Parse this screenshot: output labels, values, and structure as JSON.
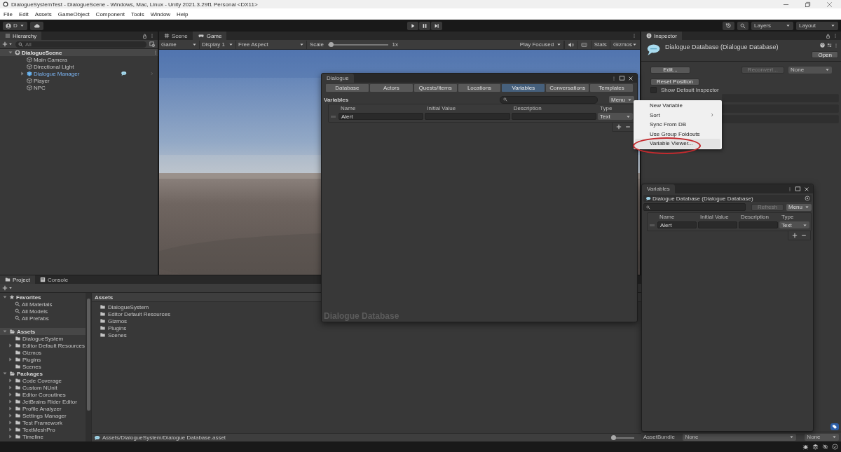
{
  "window": {
    "title": "DialogueSystemTest - DialogueScene - Windows, Mac, Linux - Unity 2021.3.29f1 Personal <DX11>"
  },
  "menu_bar": [
    "File",
    "Edit",
    "Assets",
    "GameObject",
    "Component",
    "Tools",
    "Window",
    "Help"
  ],
  "toolbar": {
    "account": "D",
    "layers": "Layers",
    "layout": "Layout"
  },
  "hierarchy": {
    "title": "Hierarchy",
    "search": {
      "placeholder": "All"
    },
    "scene": {
      "name": "DialogueScene",
      "expanded": true
    },
    "objects": [
      {
        "name": "Main Camera",
        "kind": "object",
        "expandable": false
      },
      {
        "name": "Directional Light",
        "kind": "object",
        "expandable": false
      },
      {
        "name": "Dialogue Manager",
        "kind": "prefab",
        "expandable": true
      },
      {
        "name": "Player",
        "kind": "object",
        "expandable": false
      },
      {
        "name": "NPC",
        "kind": "object",
        "expandable": false
      }
    ]
  },
  "view_tabs": [
    {
      "label": "Scene",
      "selected": false
    },
    {
      "label": "Game",
      "selected": true
    }
  ],
  "game_toolbar": {
    "mode": "Game",
    "display": "Display 1",
    "aspect": "Free Aspect",
    "scale": {
      "label": "Scale",
      "level": 0.05,
      "reading": "1x"
    },
    "play_mode": "Play Focused",
    "stats": "Stats",
    "gizmos": "Gizmos"
  },
  "game_view": {
    "kind": "picture"
  },
  "inspector": {
    "title": "Inspector",
    "header": "Dialogue Database (Dialogue Database)",
    "open_button": "Open",
    "edit_button": "Edit...",
    "reconvert_button": {
      "label": "Reconvert...",
      "disabled": true
    },
    "format_dropdown": "None",
    "reset_button": "Reset Position",
    "show_default_inspector": {
      "label": "Show Default Inspector",
      "checked": false
    },
    "asset_bundle": {
      "label": "AssetBundle",
      "name": "None",
      "variant": "None"
    }
  },
  "dialogue_editor": {
    "title": "Dialogue",
    "tabs": [
      {
        "label": "Database",
        "selected": false
      },
      {
        "label": "Actors",
        "selected": false
      },
      {
        "label": "Quests/Items",
        "selected": false
      },
      {
        "label": "Locations",
        "selected": false
      },
      {
        "label": "Variables",
        "selected": true
      },
      {
        "label": "Conversations",
        "selected": false
      },
      {
        "label": "Templates",
        "selected": false
      }
    ],
    "section_title": "Variables",
    "menu_button": "Menu",
    "columns": [
      "Name",
      "Initial Value",
      "Description",
      "Type"
    ],
    "variables": [
      {
        "name": "Alert",
        "type": "Text"
      }
    ],
    "footer": "Dialogue Database"
  },
  "context_menu": {
    "items": [
      {
        "label": "New Variable",
        "submenu": false,
        "highlighted": false
      },
      {
        "label": "Sort",
        "submenu": true,
        "highlighted": false
      },
      {
        "label": "Sync From DB",
        "submenu": false,
        "highlighted": false
      },
      {
        "label": "Use Group Foldouts",
        "submenu": false,
        "highlighted": false
      },
      {
        "label": "Variable Viewer...",
        "submenu": false,
        "highlighted": true
      }
    ]
  },
  "variables_window": {
    "title": "Variables",
    "database": "Dialogue Database (Dialogue Database)",
    "refresh_button": {
      "label": "Refresh",
      "disabled": true
    },
    "menu_button": "Menu",
    "columns": [
      "Name",
      "Initial Value",
      "Description",
      "Type"
    ],
    "variables": [
      {
        "name": "Alert",
        "type": "Text"
      }
    ]
  },
  "project": {
    "tabs": [
      {
        "label": "Project",
        "selected": true
      },
      {
        "label": "Console",
        "selected": false
      }
    ],
    "tree": [
      {
        "label": "Favorites",
        "kind": "favorites",
        "expanded": true,
        "selected": false,
        "children": [
          {
            "label": "All Materials",
            "kind": "search",
            "expandable": false
          },
          {
            "label": "All Models",
            "kind": "search",
            "expandable": false
          },
          {
            "label": "All Prefabs",
            "kind": "search",
            "expandable": false
          }
        ]
      },
      {
        "label": "Assets",
        "kind": "root",
        "expanded": true,
        "selected": true,
        "children": [
          {
            "label": "DialogueSystem",
            "kind": "folder",
            "expandable": false
          },
          {
            "label": "Editor Default Resources",
            "kind": "folder",
            "expandable": true
          },
          {
            "label": "Gizmos",
            "kind": "folder",
            "expandable": false
          },
          {
            "label": "Plugins",
            "kind": "folder",
            "expandable": true
          },
          {
            "label": "Scenes",
            "kind": "folder",
            "expandable": false
          }
        ]
      },
      {
        "label": "Packages",
        "kind": "root",
        "expanded": true,
        "selected": false,
        "children": [
          {
            "label": "Code Coverage",
            "kind": "folder",
            "expandable": true
          },
          {
            "label": "Custom NUnit",
            "kind": "folder",
            "expandable": true
          },
          {
            "label": "Editor Coroutines",
            "kind": "folder",
            "expandable": true
          },
          {
            "label": "JetBrains Rider Editor",
            "kind": "folder",
            "expandable": true
          },
          {
            "label": "Profile Analyzer",
            "kind": "folder",
            "expandable": true
          },
          {
            "label": "Settings Manager",
            "kind": "folder",
            "expandable": true
          },
          {
            "label": "Test Framework",
            "kind": "folder",
            "expandable": true
          },
          {
            "label": "TextMeshPro",
            "kind": "folder",
            "expandable": true
          },
          {
            "label": "Timeline",
            "kind": "folder",
            "expandable": true
          }
        ]
      }
    ],
    "breadcrumb": "Assets",
    "items": [
      "DialogueSystem",
      "Editor Default Resources",
      "Gizmos",
      "Plugins",
      "Scenes"
    ],
    "selected_path": "Assets/DialogueSystem/Dialogue Database.asset",
    "zoom": {
      "level": 0.05
    }
  }
}
